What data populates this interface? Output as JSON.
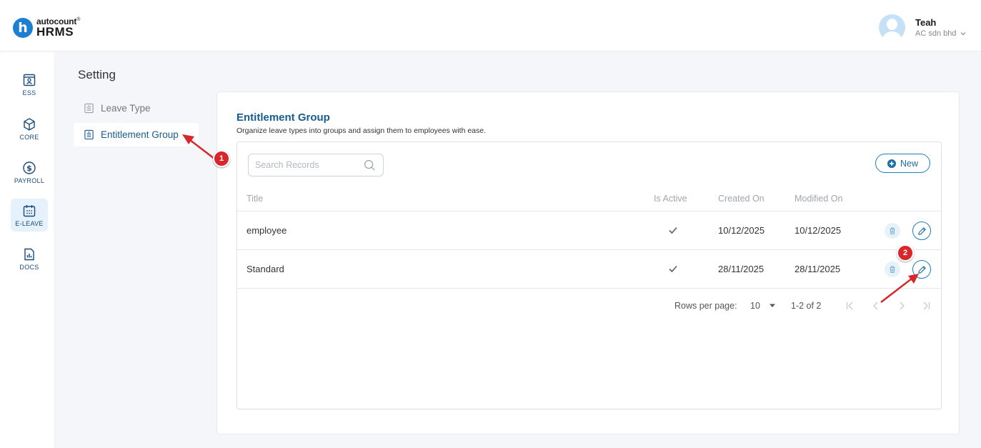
{
  "app": {
    "logo_badge": "h",
    "logo_top": "autocount",
    "logo_sup": "®",
    "logo_bottom": "HRMS"
  },
  "user": {
    "name": "Teah",
    "org": "AC sdn bhd"
  },
  "rail": [
    {
      "label": "ESS",
      "icon": "badge-icon"
    },
    {
      "label": "CORE",
      "icon": "cube-icon"
    },
    {
      "label": "PAYROLL",
      "icon": "dollar-icon"
    },
    {
      "label": "E-LEAVE",
      "icon": "calendar-icon"
    },
    {
      "label": "DOCS",
      "icon": "document-chart-icon"
    }
  ],
  "page": {
    "title": "Setting"
  },
  "settings_nav": [
    {
      "label": "Leave Type"
    },
    {
      "label": "Entitlement Group"
    }
  ],
  "card": {
    "title": "Entitlement Group",
    "description": "Organize leave types into groups and assign them to employees with ease."
  },
  "search": {
    "placeholder": "Search Records",
    "value": ""
  },
  "new_button": {
    "label": "New"
  },
  "table": {
    "columns": [
      "Title",
      "Is Active",
      "Created On",
      "Modified On"
    ],
    "rows": [
      {
        "title": "employee",
        "active": true,
        "created": "10/12/2025",
        "modified": "10/12/2025"
      },
      {
        "title": "Standard",
        "active": true,
        "created": "28/11/2025",
        "modified": "28/11/2025"
      }
    ]
  },
  "pagination": {
    "rows_per_page_label": "Rows per page:",
    "rows_per_page": "10",
    "range": "1-2 of 2"
  },
  "annotations": [
    {
      "number": "1"
    },
    {
      "number": "2"
    }
  ],
  "colors": {
    "accent": "#1d7fb8",
    "heading": "#175c8c",
    "annotation": "#d8262b",
    "rail_active": "#e5f1fb"
  }
}
